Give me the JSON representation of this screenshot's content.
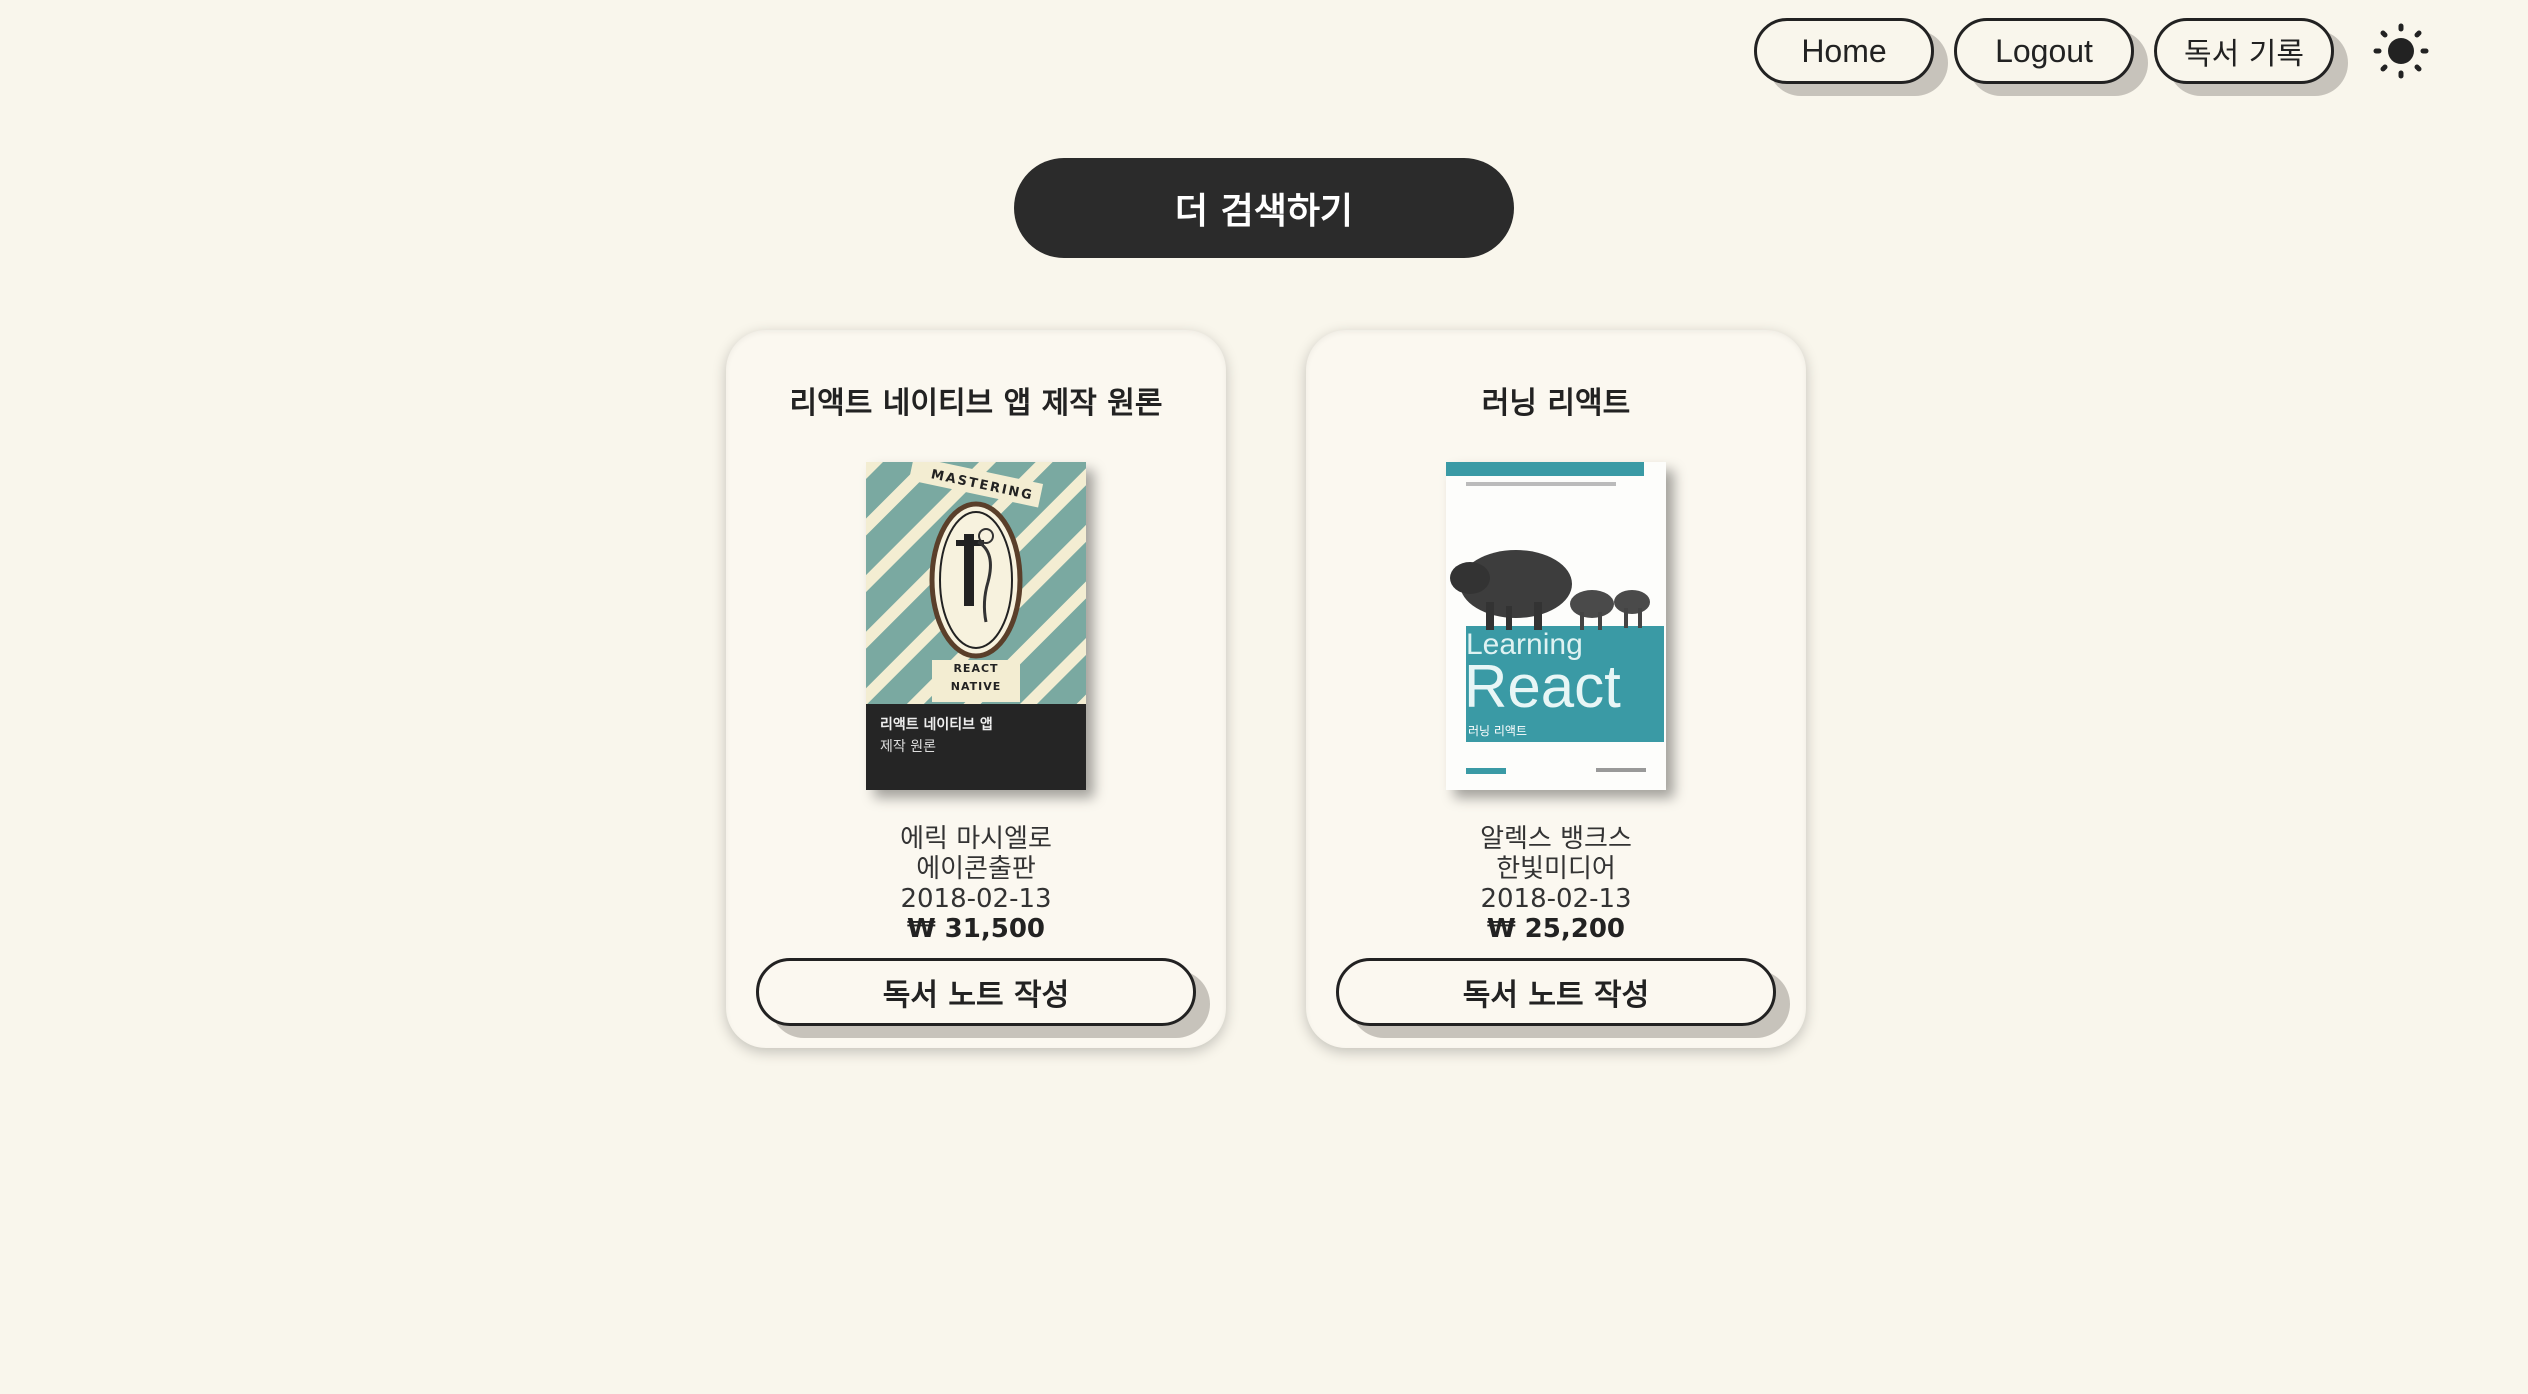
{
  "nav": {
    "home_label": "Home",
    "logout_label": "Logout",
    "reading_record_label": "독서 기록",
    "theme_icon": "sun-icon"
  },
  "search_more_label": "더 검색하기",
  "books": [
    {
      "title": "리액트 네이티브 앱 제작 원론",
      "author": "에릭 마시엘로",
      "publisher": "에이콘출판",
      "date": "2018-02-13",
      "price": "₩ 31,500",
      "button_label": "독서 노트 작성",
      "cover": {
        "top_text": "MASTERING",
        "bottom_text": "REACT NATIVE",
        "panel_title": "리액트 네이티브 앱",
        "panel_subtitle": "제작 원론"
      }
    },
    {
      "title": "러닝 리액트",
      "author": "알렉스 뱅크스",
      "publisher": "한빛미디어",
      "date": "2018-02-13",
      "price": "₩ 25,200",
      "button_label": "독서 노트 작성",
      "cover": {
        "line1": "Learning",
        "line2": "React",
        "subtitle": "러닝 리액트"
      }
    }
  ],
  "colors": {
    "background": "#f9f6ec",
    "dark_button": "#2b2b2b",
    "button_shadow": "#c7c3bb",
    "cover1_teal": "#7aa9a1",
    "cover2_teal": "#3a9aa5"
  }
}
